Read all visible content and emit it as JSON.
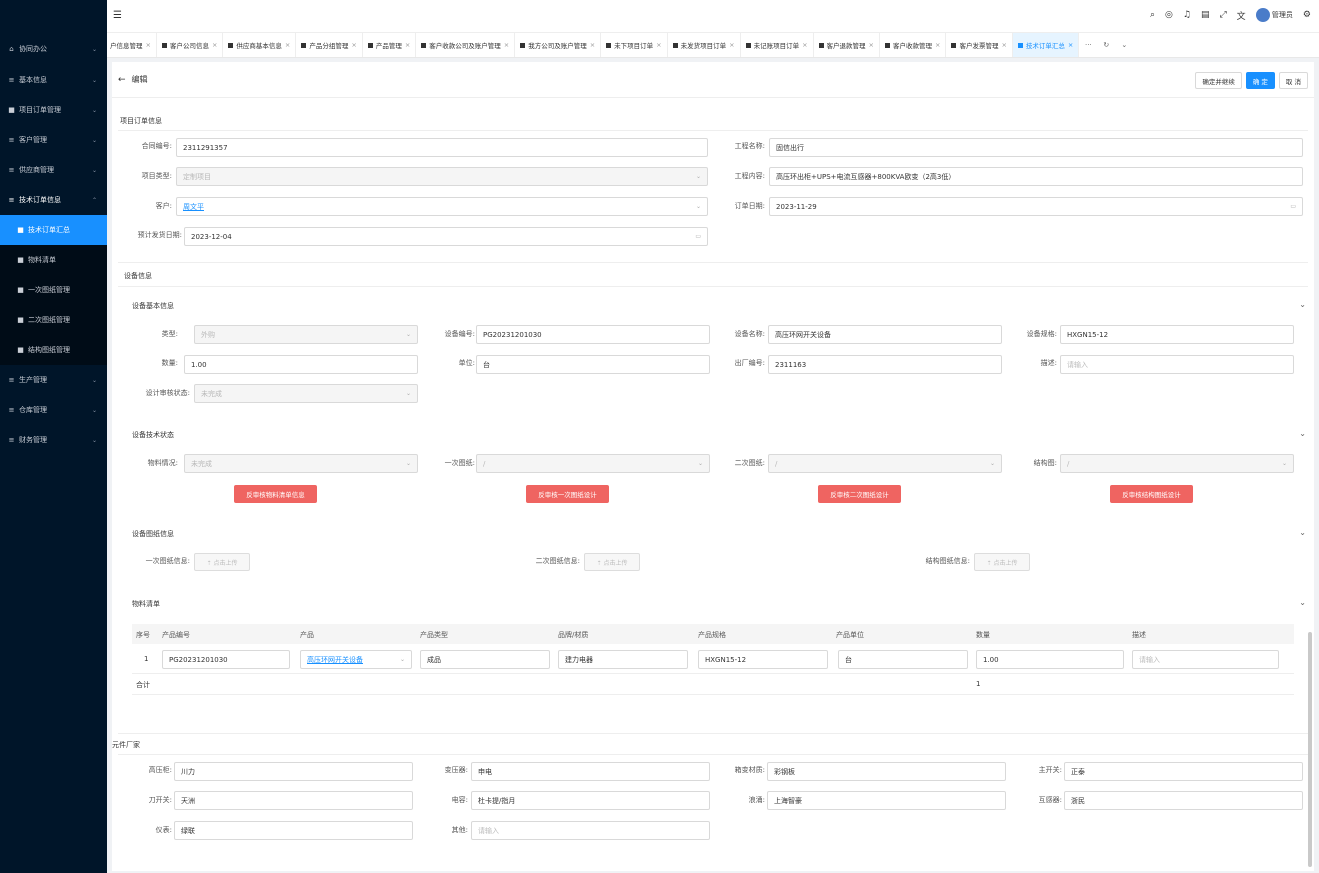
{
  "sidebar": {
    "items": [
      {
        "label": "协同办公",
        "icon": "home-icon",
        "arrow": "⌄"
      },
      {
        "label": "基本信息",
        "icon": "list-icon",
        "arrow": "⌄"
      },
      {
        "label": "项目订单管理",
        "icon": "folder-icon",
        "arrow": "⌄"
      },
      {
        "label": "客户管理",
        "icon": "list-icon",
        "arrow": "⌄"
      },
      {
        "label": "供应商管理",
        "icon": "list-icon",
        "arrow": "⌄"
      },
      {
        "label": "技术订单信息",
        "icon": "list-icon",
        "arrow": "⌃"
      }
    ],
    "sub_items": [
      "技术订单汇总",
      "物料清单",
      "一次图纸管理",
      "二次图纸管理",
      "结构图纸管理"
    ],
    "items_after": [
      {
        "label": "生产管理",
        "arrow": "⌄"
      },
      {
        "label": "仓库管理",
        "arrow": "⌄"
      },
      {
        "label": "财务管理",
        "arrow": "⌄"
      }
    ]
  },
  "topbar": {
    "user": "管理员"
  },
  "tabs": [
    "户信息管理",
    "客户公司信息",
    "供应商基本信息",
    "产品分组管理",
    "产品管理",
    "客户收款公司及账户管理",
    "我方公司及账户管理",
    "未下项目订单",
    "未发货项目订单",
    "未记账项目订单",
    "客户退款管理",
    "客户收款管理",
    "客户发票管理",
    "技术订单汇总"
  ],
  "header": {
    "title": "编辑",
    "btn_continue": "确定并继续",
    "btn_ok": "确 定",
    "btn_cancel": "取 消"
  },
  "order": {
    "title": "项目订单信息",
    "contract_label": "合同编号:",
    "contract": "2311291357",
    "project_label": "工程名称:",
    "project": "固信出行",
    "type_label": "项目类型:",
    "type": "定制项目",
    "content_label": "工程内容:",
    "content": "高压环出柜+UPS+电流互感器+800KVA欧变（2高3低）",
    "customer_label": "客户:",
    "customer": "周文平",
    "order_date_label": "订单日期:",
    "order_date": "2023-11-29",
    "ship_label": "预计发货日期:",
    "ship_date": "2023-12-04"
  },
  "device": {
    "title": "设备信息",
    "basic_title": "设备基本信息",
    "kind_label": "类型:",
    "kind": "外购",
    "no_label": "设备编号:",
    "no": "PG20231201030",
    "name_label": "设备名称:",
    "name": "高压环网开关设备",
    "spec_label": "设备规格:",
    "spec": "HXGN15-12",
    "qty_label": "数量:",
    "qty": "1.00",
    "unit_label": "单位:",
    "unit": "台",
    "factory_label": "出厂编号:",
    "factory": "2311163",
    "desc_label": "描述:",
    "desc_ph": "请输入",
    "audit_label": "设计审核状态:",
    "audit": "未完成",
    "tech_title": "设备技术状态",
    "mat_label": "物料情况:",
    "mat": "未完成",
    "d1_label": "一次图纸:",
    "d1": "/",
    "d2_label": "二次图纸:",
    "d2": "/",
    "d3_label": "结构图:",
    "d3": "/",
    "btn1": "反审核物料清单信息",
    "btn2": "反审核一次图纸设计",
    "btn3": "反审核二次图纸设计",
    "btn4": "反审核结构图纸设计",
    "draw_title": "设备图纸信息",
    "u1_label": "一次图纸信息:",
    "u2_label": "二次图纸信息:",
    "u3_label": "结构图纸信息:",
    "upload": "⇡ 点击上传",
    "bom_title": "物料清单"
  },
  "bom": {
    "headers": [
      "序号",
      "产品编号",
      "产品",
      "产品类型",
      "品牌/材质",
      "产品规格",
      "产品单位",
      "数量",
      "描述"
    ],
    "row": {
      "no": "1",
      "code": "PG20231201030",
      "product": "高压环网开关设备",
      "ptype": "成品",
      "brand": "建力电器",
      "spec": "HXGN15-12",
      "unit": "台",
      "qty": "1.00",
      "desc_ph": "请输入"
    },
    "total_label": "合计",
    "total": "1"
  },
  "vendors": {
    "title": "元件厂家",
    "f1_label": "高压柜:",
    "f1": "川力",
    "f2_label": "变压器:",
    "f2": "申电",
    "f3_label": "箱变材质:",
    "f3": "彩钢板",
    "f4_label": "主开关:",
    "f4": "正泰",
    "f5_label": "刀开关:",
    "f5": "天洲",
    "f6_label": "电容:",
    "f6": "杜卡提/指月",
    "f7_label": "浪涌:",
    "f7": "上海智豪",
    "f8_label": "互感器:",
    "f8": "浙民",
    "f9_label": "仪表:",
    "f9": "绿联",
    "f10_label": "其他:",
    "f10_ph": "请输入"
  }
}
